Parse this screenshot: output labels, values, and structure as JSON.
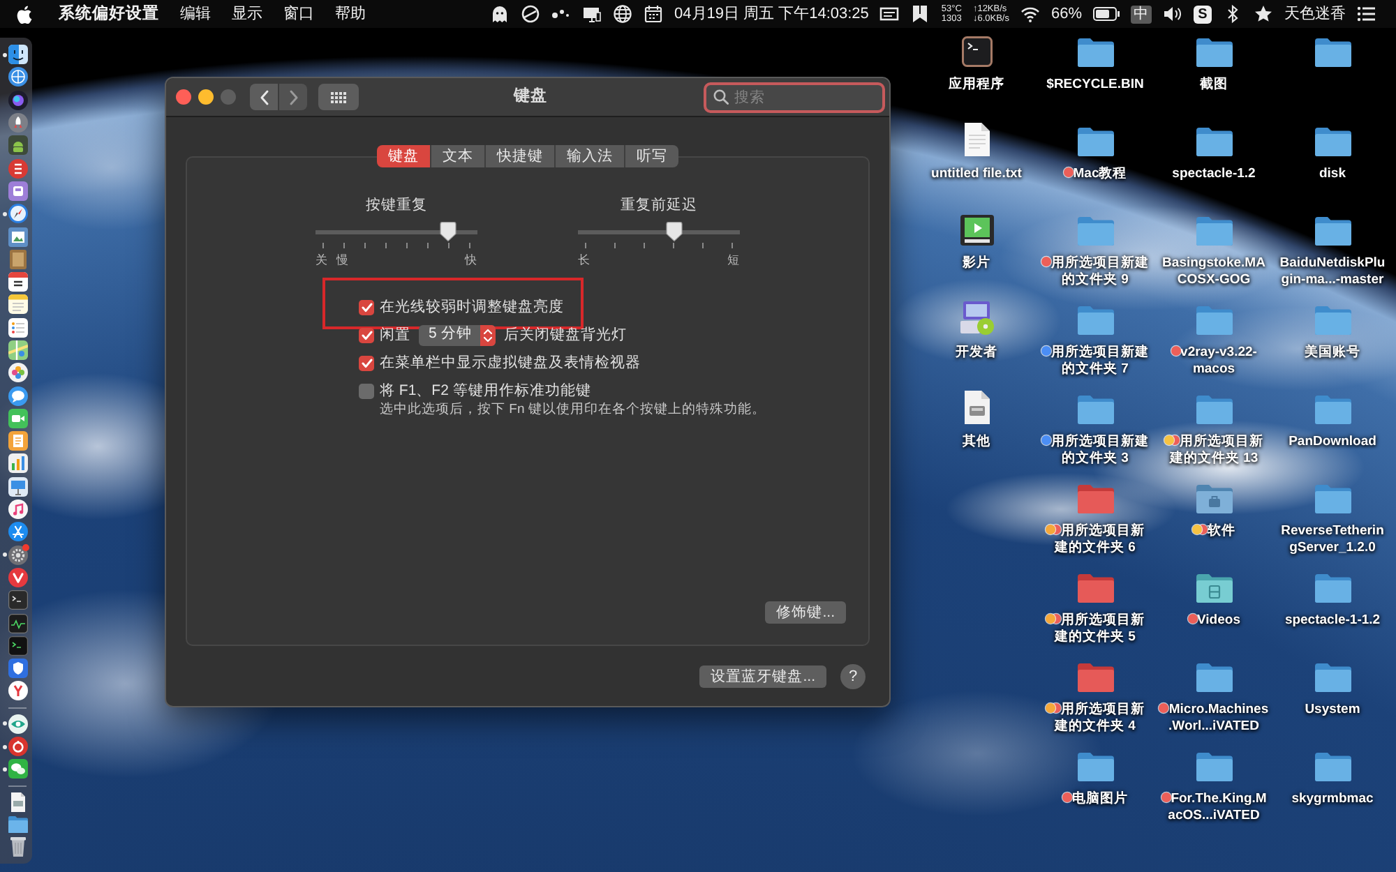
{
  "menu_bar": {
    "app_name": "系统偏好设置",
    "menus": [
      "编辑",
      "显示",
      "窗口",
      "帮助"
    ],
    "clock": "04月19日 周五 下午14:03:25",
    "sensors": [
      "53°C",
      "1303"
    ],
    "network": [
      "↑12KB/s",
      "↓6.0KB/s"
    ],
    "battery": "66%",
    "input_method": "中",
    "tray_letter": "S",
    "user": "天色迷香"
  },
  "dock": {
    "groups": [
      [
        {
          "running": true,
          "badge": false
        },
        {
          "running": false,
          "badge": false
        },
        {
          "running": false,
          "badge": false
        },
        {
          "running": false,
          "badge": false
        },
        {
          "running": false,
          "badge": false
        },
        {
          "running": false,
          "badge": false
        },
        {
          "running": false,
          "badge": false
        },
        {
          "running": true,
          "badge": false
        },
        {
          "running": false,
          "badge": false
        },
        {
          "running": false,
          "badge": false
        },
        {
          "running": false,
          "badge": false
        },
        {
          "running": false,
          "badge": false
        },
        {
          "running": false,
          "badge": false
        },
        {
          "running": false,
          "badge": false
        },
        {
          "running": false,
          "badge": false
        },
        {
          "running": false,
          "badge": false
        },
        {
          "running": false,
          "badge": false
        },
        {
          "running": false,
          "badge": false
        },
        {
          "running": false,
          "badge": false
        },
        {
          "running": false,
          "badge": false
        },
        {
          "running": false,
          "badge": false
        },
        {
          "running": false,
          "badge": false
        },
        {
          "running": true,
          "badge": true
        },
        {
          "running": false,
          "badge": false
        },
        {
          "running": false,
          "badge": false
        },
        {
          "running": false,
          "badge": false
        },
        {
          "running": false,
          "badge": false
        },
        {
          "running": false,
          "badge": false
        },
        {
          "running": false,
          "badge": false
        }
      ],
      [
        {
          "running": true,
          "badge": false
        },
        {
          "running": true,
          "badge": false
        },
        {
          "running": true,
          "badge": false
        }
      ],
      [
        {
          "running": false,
          "badge": false
        },
        {
          "running": false,
          "badge": false
        },
        {
          "running": false,
          "badge": false
        }
      ]
    ]
  },
  "window": {
    "title": "键盘",
    "traffic_lights": [
      {
        "kind": "close",
        "disabled": false
      },
      {
        "kind": "minimize",
        "disabled": false
      },
      {
        "kind": "zoom",
        "disabled": true
      }
    ],
    "nav_buttons": [
      {
        "kind": "back",
        "disabled": false
      },
      {
        "kind": "forward",
        "disabled": true
      }
    ],
    "search": {
      "placeholder": "搜索",
      "focused": true
    },
    "tabs": [
      {
        "label": "键盘",
        "selected": true
      },
      {
        "label": "文本",
        "selected": false
      },
      {
        "label": "快捷键",
        "selected": false
      },
      {
        "label": "输入法",
        "selected": false
      },
      {
        "label": "听写",
        "selected": false
      }
    ],
    "sliders": [
      {
        "label": "按键重复",
        "level": 0.857,
        "low_labels": [
          "关",
          "慢"
        ],
        "high_label": "快"
      },
      {
        "label": "重复前延迟",
        "level": 0.6,
        "low_labels": [
          "长"
        ],
        "high_label": "短"
      }
    ],
    "options": [
      {
        "kind": "plain",
        "checked": true,
        "highlighted": true,
        "label": "在光线较弱时调整键盘亮度"
      },
      {
        "kind": "timer",
        "checked": true,
        "highlighted": false,
        "label": "闲置",
        "popup": "5 分钟",
        "suffix": "后关闭键盘背光灯"
      },
      {
        "kind": "plain",
        "checked": true,
        "highlighted": false,
        "label": "在菜单栏中显示虚拟键盘及表情检视器"
      },
      {
        "kind": "plain",
        "checked": false,
        "highlighted": false,
        "label": "将 F1、F2 等键用作标准功能键",
        "note": "选中此选项后，按下 Fn 键以使用印在各个按键上的特殊功能。"
      }
    ],
    "modifier_button": "修饰键...",
    "bluetooth_button": "设置蓝牙键盘...",
    "help_button": "?"
  },
  "desktop": {
    "rows": [
      [
        {
          "kind": "terminal",
          "label": "应用程序"
        },
        {
          "kind": "folder",
          "label": "$RECYCLE.BIN"
        },
        {
          "kind": "folder",
          "label": "截图"
        },
        {
          "kind": "folder"
        }
      ],
      [
        {
          "kind": "textfile",
          "label": "untitled file.txt"
        },
        {
          "kind": "folder",
          "label": "Mac教程",
          "tags": [
            {
              "color": "#ec5f59"
            }
          ]
        },
        {
          "kind": "folder",
          "label": "spectacle-1.2"
        },
        {
          "kind": "folder",
          "label": "disk"
        }
      ],
      [
        {
          "kind": "video",
          "label": "影片"
        },
        {
          "kind": "folder",
          "label": "用所选项目新建的文件夹 9",
          "tags": [
            {
              "color": "#ec5f59"
            }
          ]
        },
        {
          "kind": "folder",
          "label": "Basingstoke.MACOSX-GOG"
        },
        {
          "kind": "folder",
          "label": "BaiduNetdiskPlugin-ma...-master"
        }
      ],
      [
        {
          "kind": "installer",
          "label": "开发者"
        },
        {
          "kind": "folder",
          "label": "用所选项目新建的文件夹 7",
          "tags": [
            {
              "color": "#4b8ef5"
            }
          ]
        },
        {
          "kind": "folder",
          "label": "v2ray-v3.22-macos",
          "tags": [
            {
              "color": "#ec5f59"
            }
          ]
        },
        {
          "kind": "folder",
          "label": "美国账号"
        }
      ],
      [
        {
          "kind": "diskfile",
          "label": "其他"
        },
        {
          "kind": "folder",
          "label": "用所选项目新建的文件夹 3",
          "tags": [
            {
              "color": "#4b8ef5"
            }
          ]
        },
        {
          "kind": "folder",
          "label": "用所选项目新建的文件夹 13",
          "tags": [
            {
              "color": "#f6c343"
            },
            {
              "color": "#ec5f59"
            }
          ]
        },
        {
          "kind": "folder",
          "label": "PanDownload"
        }
      ],
      [
        null,
        {
          "kind": "redfolder",
          "label": "用所选项目新建的文件夹 6",
          "tags": [
            {
              "color": "#f5a83b"
            },
            {
              "color": "#ec5f59"
            }
          ]
        },
        {
          "kind": "toolfolder",
          "label": "软件",
          "tags": [
            {
              "color": "#f6c343"
            },
            {
              "color": "#ec5f59"
            }
          ]
        },
        {
          "kind": "folder",
          "label": "ReverseTetheringServer_1.2.0"
        }
      ],
      [
        null,
        {
          "kind": "redfolder",
          "label": "用所选项目新建的文件夹 5",
          "tags": [
            {
              "color": "#f5a83b"
            },
            {
              "color": "#ec5f59"
            }
          ]
        },
        {
          "kind": "filmfolder",
          "label": "Videos",
          "tags": [
            {
              "color": "#ec5f59"
            }
          ]
        },
        {
          "kind": "folder",
          "label": "spectacle-1-1.2"
        }
      ],
      [
        null,
        {
          "kind": "redfolder",
          "label": "用所选项目新建的文件夹 4",
          "tags": [
            {
              "color": "#f5a83b"
            },
            {
              "color": "#ec5f59"
            }
          ]
        },
        {
          "kind": "folder",
          "label": "Micro.Machines.Worl...iVATED",
          "tags": [
            {
              "color": "#ec5f59"
            }
          ]
        },
        {
          "kind": "folder",
          "label": "Usystem"
        }
      ],
      [
        null,
        {
          "kind": "folder",
          "label": "电脑图片",
          "tags": [
            {
              "color": "#ec5f59"
            }
          ]
        },
        {
          "kind": "folder",
          "label": "For.The.King.MacOS...iVATED",
          "tags": [
            {
              "color": "#ec5f59"
            }
          ]
        },
        {
          "kind": "folder",
          "label": "skygrmbmac"
        }
      ]
    ]
  }
}
